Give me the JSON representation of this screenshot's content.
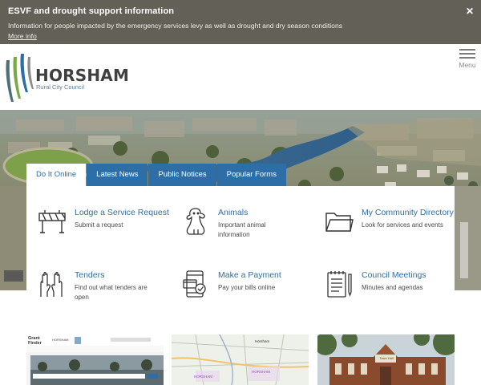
{
  "alert": {
    "title": "ESVF and drought support information",
    "description": "Information for people impacted by the emergency services levy as well as drought and dry season conditions",
    "more_link": "More info",
    "close_glyph": "✕"
  },
  "header": {
    "logo_name": "HORSHAM",
    "logo_subtitle": "Rural City Council",
    "menu_label": "Menu"
  },
  "tabs": [
    {
      "label": "Do It Online",
      "active": true
    },
    {
      "label": "Latest News",
      "active": false
    },
    {
      "label": "Public Notices",
      "active": false
    },
    {
      "label": "Popular Forms",
      "active": false
    }
  ],
  "services": [
    {
      "title": "Lodge a Service Request",
      "description": "Submit a request",
      "icon": "barrier-icon"
    },
    {
      "title": "Animals",
      "description": "Important animal information",
      "icon": "dog-icon"
    },
    {
      "title": "My Community Directory",
      "description": "Look for services and events",
      "icon": "folder-icon"
    },
    {
      "title": "Tenders",
      "description": "Find out what tenders are open",
      "icon": "raised-hands-icon"
    },
    {
      "title": "Make a Payment",
      "description": "Pay your bills online",
      "icon": "payment-phone-icon"
    },
    {
      "title": "Council Meetings",
      "description": "Minutes and agendas",
      "icon": "notepad-pen-icon"
    }
  ],
  "cards": {
    "grant_finder": {
      "title_line1": "Grant",
      "title_line2": "Finder",
      "logo_text": "HORSHAM"
    },
    "map": {
      "label_top": "Horsham",
      "label_mid": "HORSHAM",
      "label_right": "HORSHAM"
    },
    "building": {
      "sign_text": "Town Hall"
    }
  },
  "colors": {
    "alert_bg": "#636058",
    "brand_blue": "#2e6ea6",
    "logo_text": "#3f3f3f",
    "logo_sub": "#5f7f93"
  }
}
